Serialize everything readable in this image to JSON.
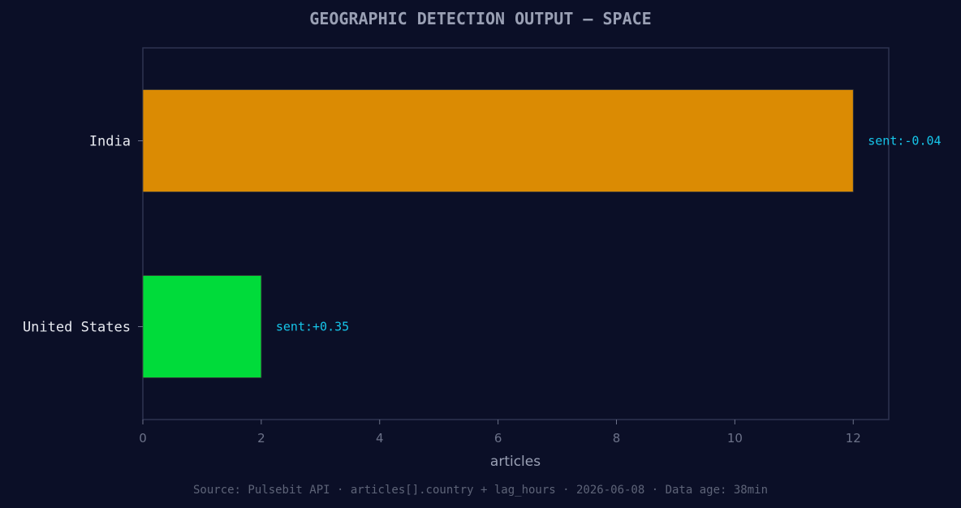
{
  "chart_data": {
    "type": "bar",
    "orientation": "horizontal",
    "title": "GEOGRAPHIC DETECTION OUTPUT — SPACE",
    "xlabel": "articles",
    "ylabel": "",
    "categories": [
      "India",
      "United States"
    ],
    "values": [
      12,
      2
    ],
    "bar_labels": [
      "sent:-0.04",
      "sent:+0.35"
    ],
    "bar_colors": [
      "#db8b03",
      "#00db3a"
    ],
    "xlim": [
      0,
      12.6
    ],
    "xticks": [
      0,
      2,
      4,
      6,
      8,
      10,
      12
    ],
    "grid": false,
    "footer": "Source: Pulsebit API · articles[].country + lag_hours · 2026-06-08 · Data age: 38min"
  },
  "colors": {
    "background": "#0b0f27",
    "plot_border": "#2e3350",
    "title": "#9aa0b4",
    "tick_label": "#6c7289",
    "category_label": "#e6e8ef",
    "bar_label": "#16c6ea",
    "footer": "#5e6478"
  }
}
